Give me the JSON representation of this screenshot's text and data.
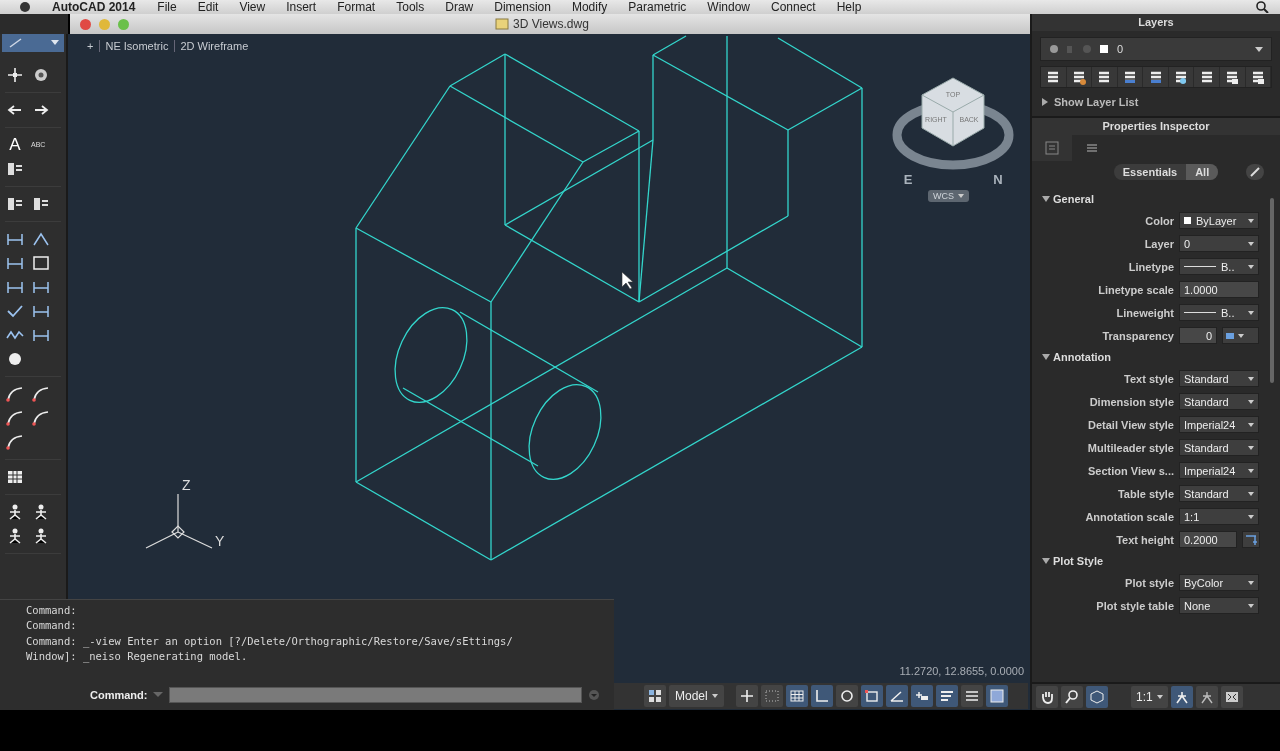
{
  "menu_bar": {
    "app_name": "AutoCAD 2014",
    "items": [
      "File",
      "Edit",
      "View",
      "Insert",
      "Format",
      "Tools",
      "Draw",
      "Dimension",
      "Modify",
      "Parametric",
      "Window",
      "Connect",
      "Help"
    ]
  },
  "document": {
    "title": "3D Views.dwg",
    "viewport_controls": [
      "+",
      "NE Isometric",
      "2D Wireframe"
    ]
  },
  "left_toolbar": {
    "text_tool": "A",
    "spell_tool": "ABC"
  },
  "viewcube": {
    "faces": [
      "TOP",
      "RIGHT",
      "BACK"
    ],
    "compass": [
      "E",
      "N"
    ],
    "coordinate_system": "WCS"
  },
  "ucs_icon": {
    "axes": [
      "Z",
      "Y"
    ]
  },
  "command_window": {
    "history": [
      "Command:",
      "Command:",
      "Command: _-view Enter an option [?/Delete/Orthographic/Restore/Save/sEttings/",
      "Window]: _neiso Regenerating model."
    ],
    "prompt": "Command:"
  },
  "coordinates": "11.2720, 12.8655, 0.0000",
  "status_bar": {
    "layout": "Model",
    "toggles": [
      {
        "kind": "infer",
        "on": false
      },
      {
        "kind": "snap",
        "on": false
      },
      {
        "kind": "grid",
        "on": true
      },
      {
        "kind": "ortho",
        "on": true
      },
      {
        "kind": "polar",
        "on": false
      },
      {
        "kind": "osnap",
        "on": true
      },
      {
        "kind": "otrack",
        "on": true
      },
      {
        "kind": "ducs",
        "on": true
      },
      {
        "kind": "dyn",
        "on": true
      },
      {
        "kind": "lineweight",
        "on": false
      },
      {
        "kind": "transparency",
        "on": true
      }
    ],
    "annotation_scale": "1:1",
    "annotation_visibility": true,
    "auto_scale": false
  },
  "layers": {
    "title": "Layers",
    "current_layer": "0",
    "show_list": {
      "label": "Show Layer List",
      "expanded": false
    }
  },
  "properties": {
    "title": "Properties Inspector",
    "tabs": [
      {
        "label": "Essentials",
        "selected": false
      },
      {
        "label": "All",
        "selected": true
      }
    ],
    "sections": [
      {
        "title": "General",
        "expanded": true,
        "rows": [
          {
            "label": "Color",
            "value": "ByLayer",
            "kind": "color"
          },
          {
            "label": "Layer",
            "value": "0",
            "kind": "dropdown"
          },
          {
            "label": "Linetype",
            "value": "B..",
            "kind": "line"
          },
          {
            "label": "Linetype scale",
            "value": "1.0000",
            "kind": "text"
          },
          {
            "label": "Lineweight",
            "value": "B..",
            "kind": "line"
          },
          {
            "label": "Transparency",
            "value": "0",
            "kind": "transparency"
          }
        ]
      },
      {
        "title": "Annotation",
        "expanded": true,
        "rows": [
          {
            "label": "Text style",
            "value": "Standard",
            "kind": "dropdown"
          },
          {
            "label": "Dimension style",
            "value": "Standard",
            "kind": "dropdown"
          },
          {
            "label": "Detail View style",
            "value": "Imperial24",
            "kind": "dropdown"
          },
          {
            "label": "Multileader style",
            "value": "Standard",
            "kind": "dropdown"
          },
          {
            "label": "Section View s...",
            "value": "Imperial24",
            "kind": "dropdown"
          },
          {
            "label": "Table style",
            "value": "Standard",
            "kind": "dropdown"
          },
          {
            "label": "Annotation scale",
            "value": "1:1",
            "kind": "dropdown"
          },
          {
            "label": "Text height",
            "value": "0.2000",
            "kind": "text_pick"
          }
        ]
      },
      {
        "title": "Plot Style",
        "expanded": true,
        "rows": [
          {
            "label": "Plot style",
            "value": "ByColor",
            "kind": "dropdown"
          },
          {
            "label": "Plot style table",
            "value": "None",
            "kind": "dropdown"
          }
        ]
      }
    ]
  }
}
